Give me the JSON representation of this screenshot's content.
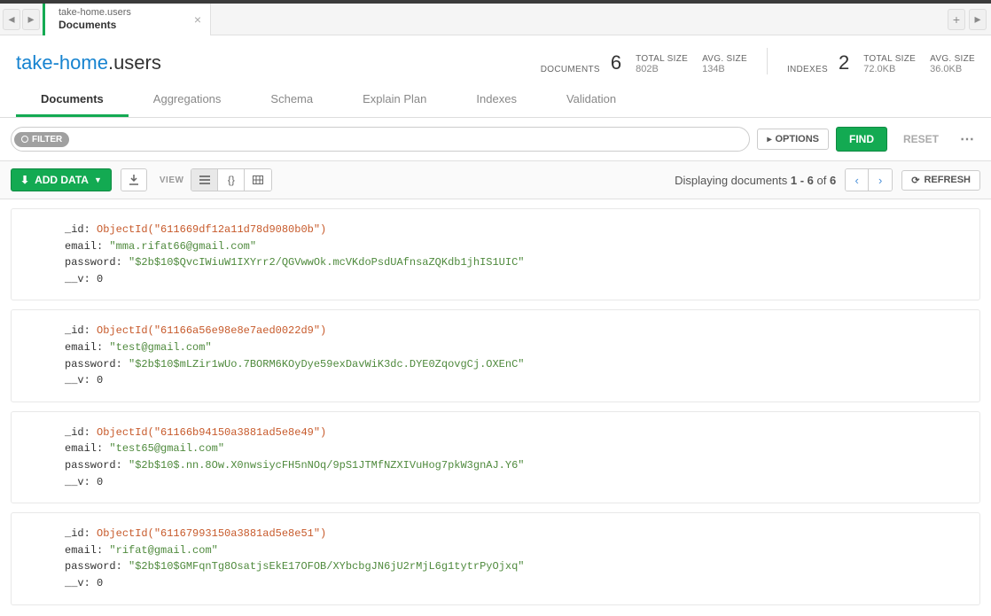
{
  "tab": {
    "title": "take-home.users",
    "subtitle": "Documents"
  },
  "namespace": {
    "db": "take-home",
    "coll": ".users"
  },
  "stats": {
    "documents_label": "DOCUMENTS",
    "documents_count": "6",
    "total_size_label": "TOTAL SIZE",
    "total_size": "802B",
    "avg_size_label": "AVG. SIZE",
    "avg_size": "134B",
    "indexes_label": "INDEXES",
    "indexes_count": "2",
    "idx_total_size_label": "TOTAL SIZE",
    "idx_total_size": "72.0KB",
    "idx_avg_size_label": "AVG. SIZE",
    "idx_avg_size": "36.0KB"
  },
  "navtabs": {
    "documents": "Documents",
    "aggregations": "Aggregations",
    "schema": "Schema",
    "explain": "Explain Plan",
    "indexes": "Indexes",
    "validation": "Validation"
  },
  "filter": {
    "pill": "FILTER",
    "options": "OPTIONS",
    "find": "FIND",
    "reset": "RESET"
  },
  "toolbar": {
    "add_data": "ADD DATA",
    "view": "VIEW",
    "display_prefix": "Displaying documents ",
    "display_range": "1 - 6",
    "display_of": " of ",
    "display_total": "6",
    "refresh": "REFRESH"
  },
  "docs": [
    {
      "_id": "ObjectId(\"611669df12a11d78d9080b0b\")",
      "email": "\"mma.rifat66@gmail.com\"",
      "password": "\"$2b$10$QvcIWiuW1IXYrr2/QGVwwOk.mcVKdoPsdUAfnsaZQKdb1jhIS1UIC\"",
      "__v": "0"
    },
    {
      "_id": "ObjectId(\"61166a56e98e8e7aed0022d9\")",
      "email": "\"test@gmail.com\"",
      "password": "\"$2b$10$mLZir1wUo.7BORM6KOyDye59exDavWiK3dc.DYE0ZqovgCj.OXEnC\"",
      "__v": "0"
    },
    {
      "_id": "ObjectId(\"61166b94150a3881ad5e8e49\")",
      "email": "\"test65@gmail.com\"",
      "password": "\"$2b$10$.nn.8Ow.X0nwsiycFH5nNOq/9pS1JTMfNZXIVuHog7pkW3gnAJ.Y6\"",
      "__v": "0"
    },
    {
      "_id": "ObjectId(\"61167993150a3881ad5e8e51\")",
      "email": "\"rifat@gmail.com\"",
      "password": "\"$2b$10$GMFqnTg8OsatjsEkE17OFOB/XYbcbgJN6jU2rMjL6g1tytrPyOjxq\"",
      "__v": "0"
    }
  ]
}
